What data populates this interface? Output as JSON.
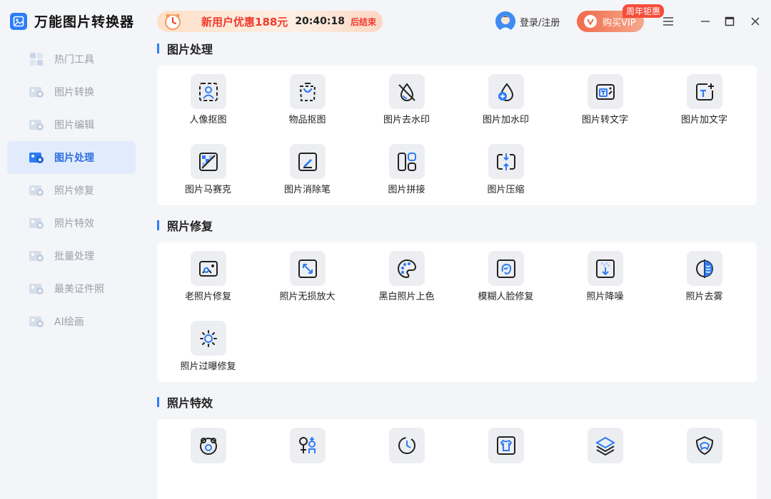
{
  "app": {
    "title": "万能图片转换器"
  },
  "sidebar": {
    "items": [
      {
        "label": "热门工具",
        "icon": "grid-icon"
      },
      {
        "label": "图片转换",
        "icon": "image-convert-icon"
      },
      {
        "label": "图片编辑",
        "icon": "image-edit-icon"
      },
      {
        "label": "图片处理",
        "icon": "image-process-icon",
        "active": true
      },
      {
        "label": "照片修复",
        "icon": "photo-repair-icon"
      },
      {
        "label": "照片特效",
        "icon": "photo-effect-icon"
      },
      {
        "label": "批量处理",
        "icon": "batch-icon"
      },
      {
        "label": "最美证件照",
        "icon": "id-photo-icon"
      },
      {
        "label": "AI绘画",
        "icon": "ai-paint-icon"
      }
    ]
  },
  "header": {
    "promo_text": "新用户优惠188元",
    "promo_time": "20:40:18",
    "promo_end": "后结束",
    "login": "登录/注册",
    "vip_label": "购买VIP",
    "vip_badge": "周年钜惠"
  },
  "sections": [
    {
      "title": "图片处理",
      "tools": [
        {
          "label": "人像抠图",
          "icon": "portrait-cutout-icon"
        },
        {
          "label": "物品抠图",
          "icon": "object-cutout-icon"
        },
        {
          "label": "图片去水印",
          "icon": "remove-watermark-icon"
        },
        {
          "label": "图片加水印",
          "icon": "add-watermark-icon"
        },
        {
          "label": "图片转文字",
          "icon": "image-to-text-icon"
        },
        {
          "label": "图片加文字",
          "icon": "add-text-icon"
        },
        {
          "label": "图片马赛克",
          "icon": "mosaic-icon"
        },
        {
          "label": "图片消除笔",
          "icon": "eraser-pen-icon"
        },
        {
          "label": "图片拼接",
          "icon": "collage-icon"
        },
        {
          "label": "图片压缩",
          "icon": "compress-icon"
        }
      ]
    },
    {
      "title": "照片修复",
      "tools": [
        {
          "label": "老照片修复",
          "icon": "old-photo-icon"
        },
        {
          "label": "照片无损放大",
          "icon": "enlarge-icon"
        },
        {
          "label": "黑白照片上色",
          "icon": "palette-icon"
        },
        {
          "label": "模糊人脸修复",
          "icon": "face-repair-icon"
        },
        {
          "label": "照片降噪",
          "icon": "denoise-icon"
        },
        {
          "label": "照片去雾",
          "icon": "defog-icon"
        },
        {
          "label": "照片过曝修复",
          "icon": "overexposure-icon"
        }
      ]
    },
    {
      "title": "照片特效",
      "tools": [
        {
          "label": "",
          "icon": "bear-face-icon"
        },
        {
          "label": "",
          "icon": "gender-icon"
        },
        {
          "label": "",
          "icon": "age-clock-icon"
        },
        {
          "label": "",
          "icon": "tshirt-icon"
        },
        {
          "label": "",
          "icon": "layers-icon"
        },
        {
          "label": "",
          "icon": "hair-icon"
        }
      ]
    }
  ],
  "colors": {
    "accent": "#2d7cf6",
    "promo_red": "#f03a2e",
    "vip": "#f3694a"
  }
}
